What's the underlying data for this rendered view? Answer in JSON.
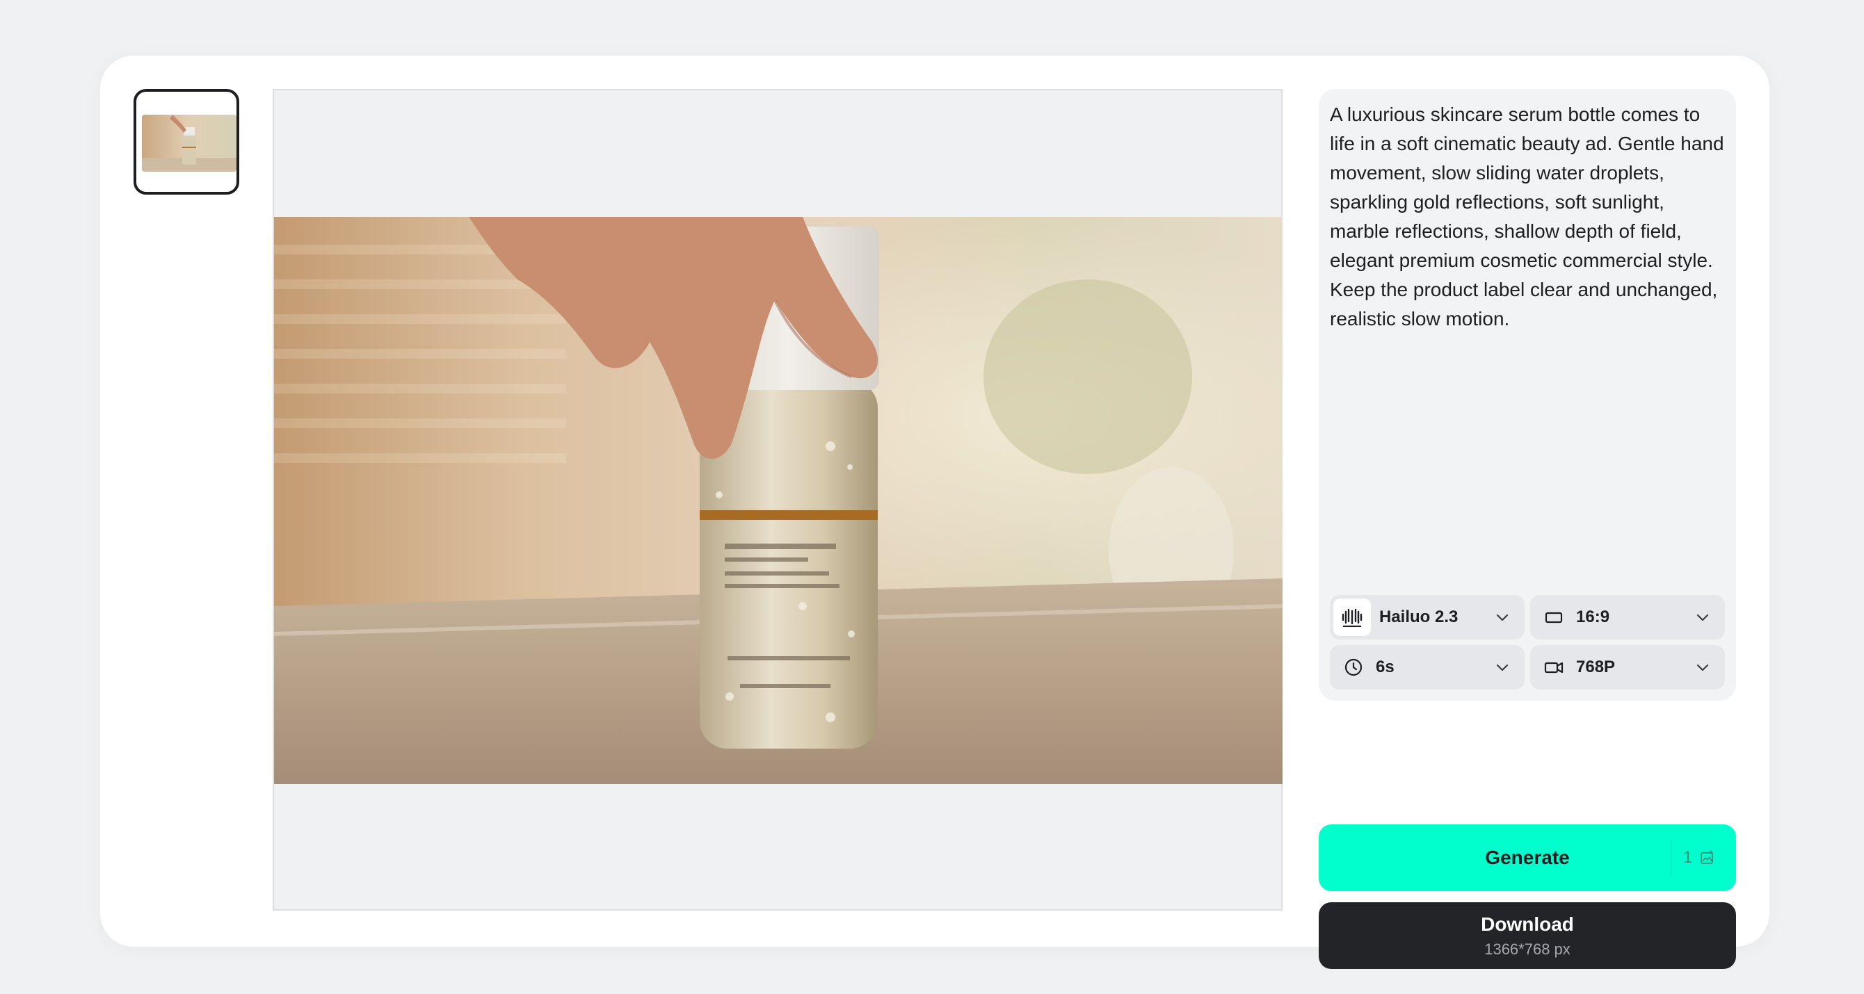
{
  "prompt": {
    "text": "A luxurious skincare serum bottle comes to life in a soft cinematic beauty ad. Gentle hand movement, slow sliding water droplets, sparkling gold reflections, soft sunlight, marble reflections, shallow depth of field, elegant premium cosmetic commercial style. Keep the product label clear and unchanged, realistic slow motion."
  },
  "options": {
    "model": {
      "label": "Hailuo 2.3",
      "icon": "minimax-logo-icon"
    },
    "aspect_ratio": {
      "label": "16:9",
      "icon": "rectangle-icon"
    },
    "duration": {
      "label": "6s",
      "icon": "clock-icon"
    },
    "resolution": {
      "label": "768P",
      "icon": "video-camera-icon"
    }
  },
  "generate": {
    "label": "Generate",
    "credit_count": "1",
    "credit_icon": "credit-image-icon"
  },
  "download": {
    "label": "Download",
    "size": "1366*768 px"
  },
  "colors": {
    "accent": "#00ffcc",
    "dark_button": "#222428",
    "page_bg": "#f0f1f3",
    "panel_bg": "#f2f3f5",
    "option_bg": "#e6e7ea"
  }
}
